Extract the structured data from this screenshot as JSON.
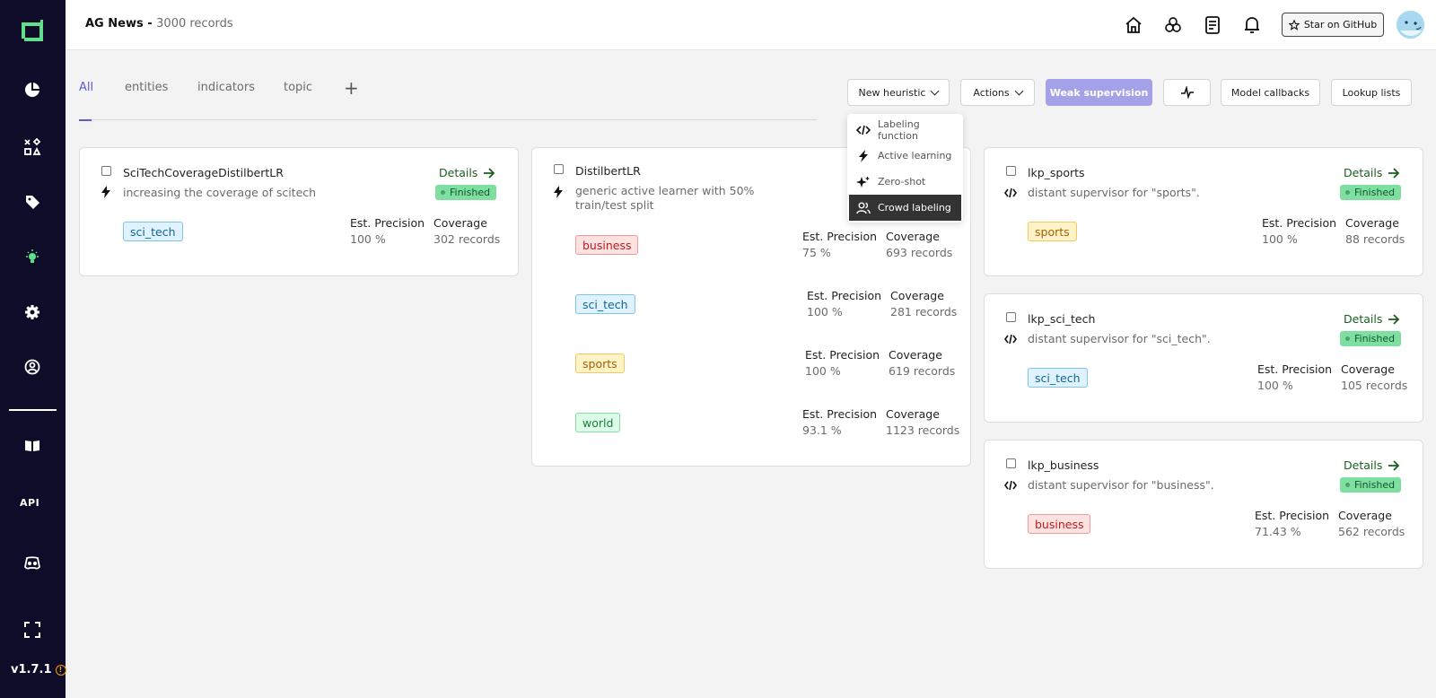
{
  "header": {
    "project": "AG News",
    "separator": " - ",
    "records": "3000 records",
    "github_label": "Star on GitHub"
  },
  "sidebar": {
    "api_label": "API",
    "version": "v1.7.1"
  },
  "tabs": [
    {
      "label": "All",
      "active": true
    },
    {
      "label": "entities"
    },
    {
      "label": "indicators"
    },
    {
      "label": "topic"
    }
  ],
  "toolbar": {
    "new_heuristic": "New heuristic",
    "actions": "Actions",
    "weak_supervision": "Weak supervision",
    "model_callbacks": "Model callbacks",
    "lookup_lists": "Lookup lists"
  },
  "dropdown": [
    {
      "label": "Labeling function",
      "icon": "code-icon"
    },
    {
      "label": "Active learning",
      "icon": "bolt-icon"
    },
    {
      "label": "Zero-shot",
      "icon": "sparkles-icon"
    },
    {
      "label": "Crowd labeling",
      "icon": "users-icon",
      "selected": true
    }
  ],
  "common": {
    "details": "Details",
    "finished": "Finished",
    "est_precision": "Est. Precision",
    "coverage": "Coverage"
  },
  "cards": [
    {
      "name": "SciTechCoverageDistilbertLR",
      "type": "active-learning",
      "description": "increasing the coverage of scitech",
      "status": "Finished",
      "labels": [
        {
          "label": "sci_tech",
          "precision": "100 %",
          "coverage": "302 records"
        }
      ]
    },
    {
      "name": "DistilbertLR",
      "type": "active-learning",
      "description_lines": [
        "generic active learner with 50%",
        "train/test split"
      ],
      "labels": [
        {
          "label": "business",
          "precision": "75 %",
          "coverage": "693 records"
        },
        {
          "label": "sci_tech",
          "precision": "100 %",
          "coverage": "281 records"
        },
        {
          "label": "sports",
          "precision": "100 %",
          "coverage": "619 records"
        },
        {
          "label": "world",
          "precision": "93.1 %",
          "coverage": "1123 records"
        }
      ]
    },
    {
      "name": "lkp_sports",
      "type": "labeling-function",
      "description": "distant supervisor for \"sports\".",
      "status": "Finished",
      "labels": [
        {
          "label": "sports",
          "precision": "100 %",
          "coverage": "88 records"
        }
      ]
    },
    {
      "name": "lkp_sci_tech",
      "type": "labeling-function",
      "description": "distant supervisor for \"sci_tech\".",
      "status": "Finished",
      "labels": [
        {
          "label": "sci_tech",
          "precision": "100 %",
          "coverage": "105 records"
        }
      ]
    },
    {
      "name": "lkp_business",
      "type": "labeling-function",
      "description": "distant supervisor for \"business\".",
      "status": "Finished",
      "labels": [
        {
          "label": "business",
          "precision": "71.43 %",
          "coverage": "562 records"
        }
      ]
    }
  ],
  "colors": {
    "sidebar": "#0f0c29",
    "accent": "#5b5bd6",
    "weak_supervision": "#a5a1e8",
    "finished": "#7ee0a0",
    "details": "#1b5e20"
  }
}
